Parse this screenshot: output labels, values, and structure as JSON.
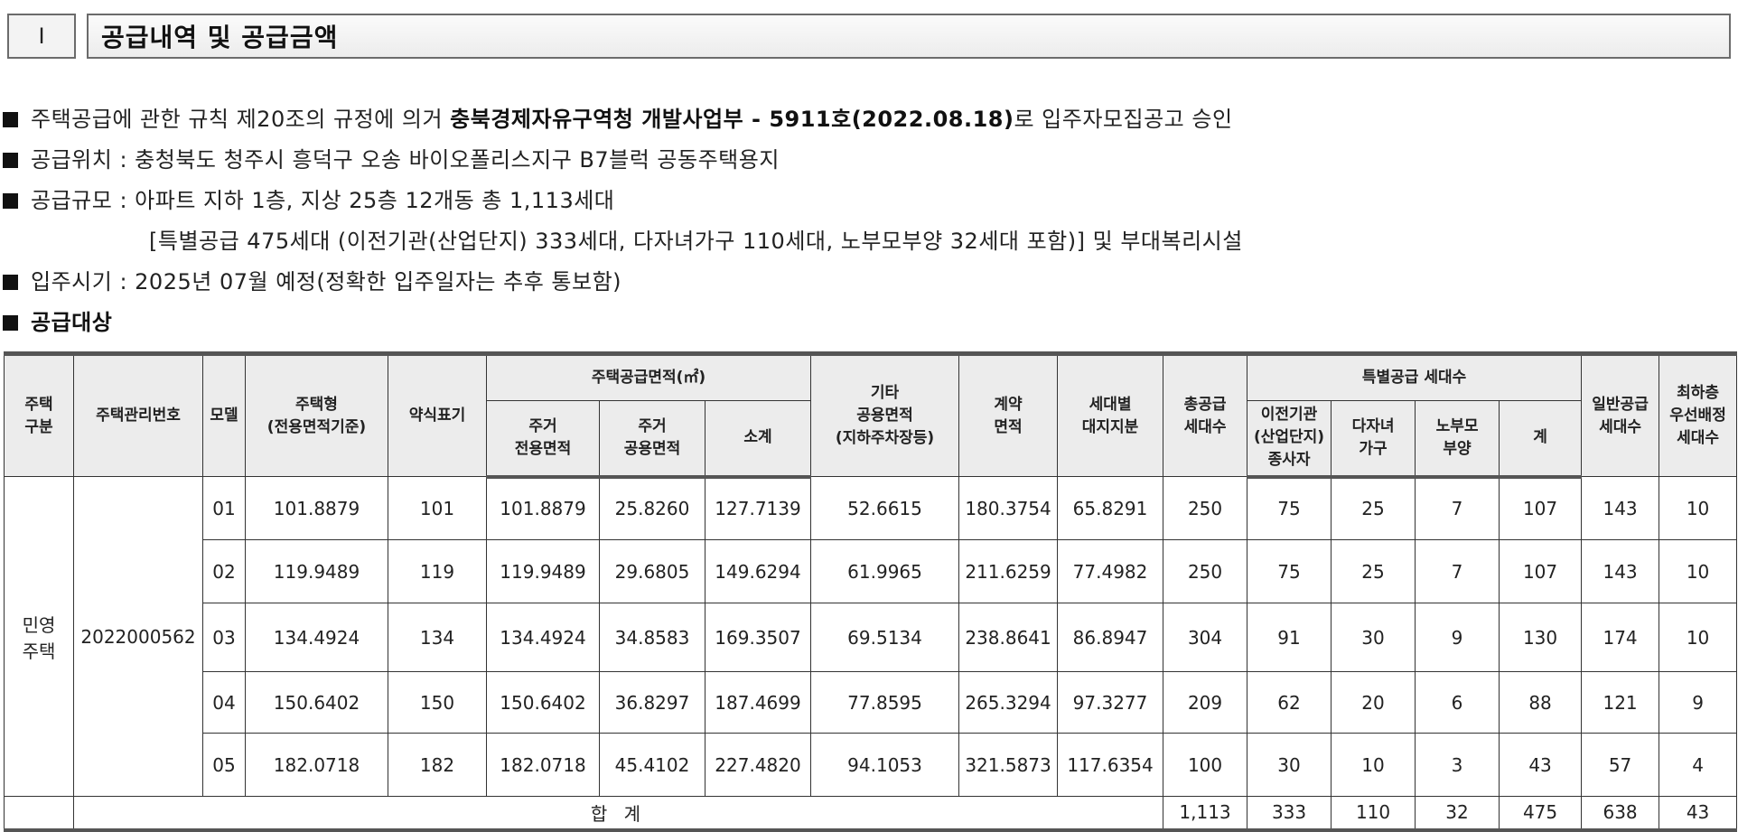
{
  "header": {
    "section_number": "Ⅰ",
    "title": "공급내역 및 공급금액"
  },
  "bullets": {
    "line1_prefix": "주택공급에 관한 규칙 제20조의 규정에 의거 ",
    "line1_bold": "충북경제자유구역청 개발사업부 - 5911호(2022.08.18)",
    "line1_suffix": "로 입주자모집공고 승인",
    "line2": "공급위치 : 충청북도 청주시 흥덕구 오송 바이오폴리스지구 B7블럭 공동주택용지",
    "line3": "공급규모 : 아파트 지하 1층, 지상 25층 12개동 총 1,113세대",
    "line3_cont": "[특별공급 475세대 (이전기관(산업단지) 333세대, 다자녀가구 110세대, 노부모부양 32세대 포함)] 및 부대복리시설",
    "line4": "입주시기 : 2025년 07월 예정(정확한 입주일자는 추후 통보함)",
    "line5": "공급대상"
  },
  "table": {
    "headers": {
      "housing_type_class": "주택\n구분",
      "mgmt_no": "주택관리번호",
      "model": "모델",
      "house_type": "주택형\n(전용면적기준)",
      "abbrev": "약식표기",
      "supply_area_group": "주택공급면적(㎡)",
      "exclusive": "주거\n전용면적",
      "common": "주거\n공용면적",
      "subtotal": "소계",
      "other_common": "기타\n공용면적\n(지하주차장등)",
      "contract_area": "계약\n면적",
      "land_share": "세대별\n대지지분",
      "total_supply": "총공급\n세대수",
      "special_group": "특별공급 세대수",
      "relocated": "이전기관\n(산업단지)\n종사자",
      "multi_child": "다자녀\n가구",
      "elderly": "노부모\n부양",
      "special_total": "계",
      "general": "일반공급\n세대수",
      "lowest_floor": "최하층\n우선배정\n세대수"
    },
    "category": "민영\n주택",
    "management_number": "2022000562",
    "rows": [
      {
        "model": "01",
        "type": "101.8879",
        "abbr": "101",
        "excl": "101.8879",
        "comm": "25.8260",
        "sub": "127.7139",
        "other": "52.6615",
        "contract": "180.3754",
        "land": "65.8291",
        "total": "250",
        "reloc": "75",
        "multi": "25",
        "elder": "7",
        "sp_total": "107",
        "general": "143",
        "lowest": "10"
      },
      {
        "model": "02",
        "type": "119.9489",
        "abbr": "119",
        "excl": "119.9489",
        "comm": "29.6805",
        "sub": "149.6294",
        "other": "61.9965",
        "contract": "211.6259",
        "land": "77.4982",
        "total": "250",
        "reloc": "75",
        "multi": "25",
        "elder": "7",
        "sp_total": "107",
        "general": "143",
        "lowest": "10"
      },
      {
        "model": "03",
        "type": "134.4924",
        "abbr": "134",
        "excl": "134.4924",
        "comm": "34.8583",
        "sub": "169.3507",
        "other": "69.5134",
        "contract": "238.8641",
        "land": "86.8947",
        "total": "304",
        "reloc": "91",
        "multi": "30",
        "elder": "9",
        "sp_total": "130",
        "general": "174",
        "lowest": "10"
      },
      {
        "model": "04",
        "type": "150.6402",
        "abbr": "150",
        "excl": "150.6402",
        "comm": "36.8297",
        "sub": "187.4699",
        "other": "77.8595",
        "contract": "265.3294",
        "land": "97.3277",
        "total": "209",
        "reloc": "62",
        "multi": "20",
        "elder": "6",
        "sp_total": "88",
        "general": "121",
        "lowest": "9"
      },
      {
        "model": "05",
        "type": "182.0718",
        "abbr": "182",
        "excl": "182.0718",
        "comm": "45.4102",
        "sub": "227.4820",
        "other": "94.1053",
        "contract": "321.5873",
        "land": "117.6354",
        "total": "100",
        "reloc": "30",
        "multi": "10",
        "elder": "3",
        "sp_total": "43",
        "general": "57",
        "lowest": "4"
      }
    ],
    "totals": {
      "label": "합 계",
      "total": "1,113",
      "reloc": "333",
      "multi": "110",
      "elder": "32",
      "sp_total": "475",
      "general": "638",
      "lowest": "43"
    }
  }
}
